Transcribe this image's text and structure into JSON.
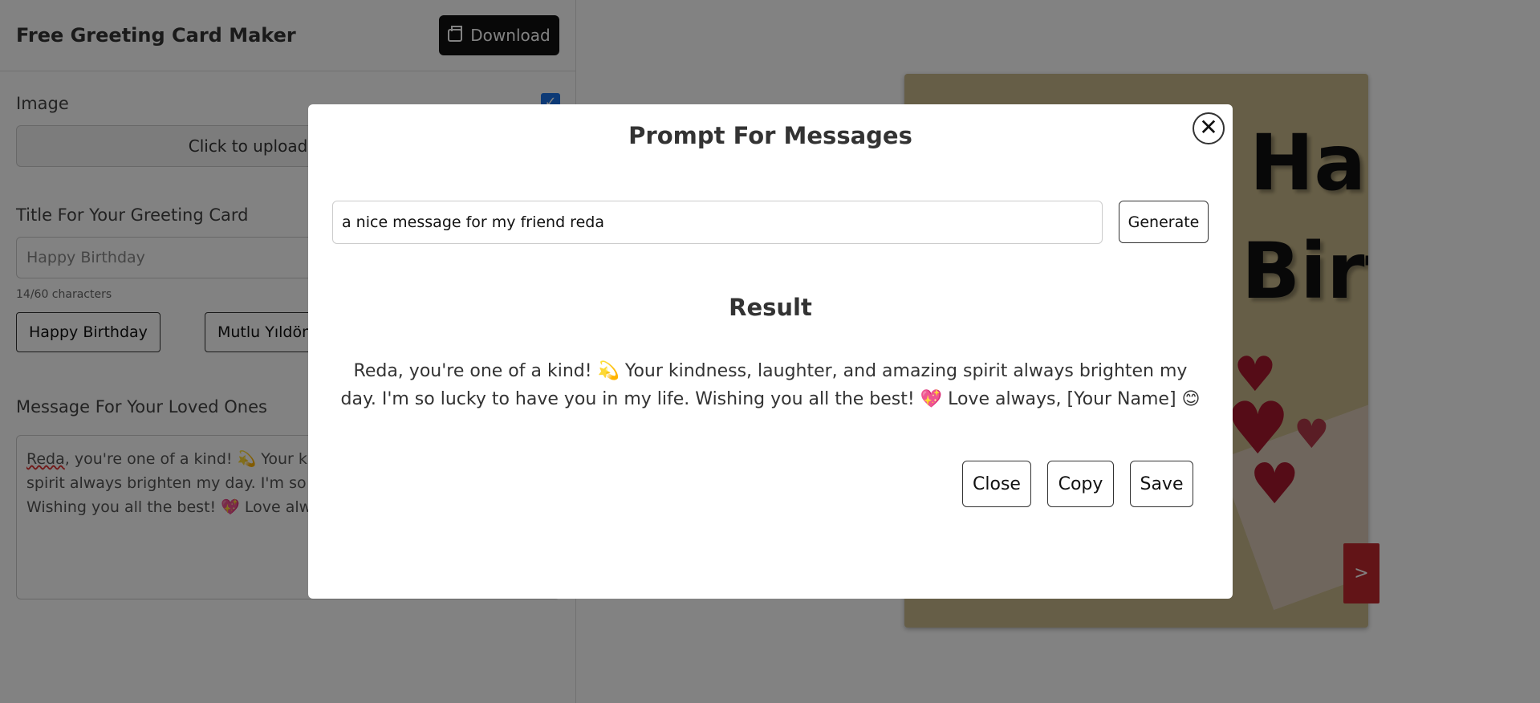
{
  "app": {
    "title": "Free Greeting Card Maker",
    "download_label": "Download"
  },
  "editor": {
    "image_label": "Image",
    "image_checked": true,
    "upload_label": "Click to upload an image",
    "title_label": "Title For Your Greeting Card",
    "title_placeholder": "Happy Birthday",
    "char_count": "14/60 characters",
    "presets": [
      "Happy Birthday",
      "Mutlu Yıldönümü"
    ],
    "message_label": "Message For Your Loved Ones",
    "message_word_1": "Reda",
    "message_rest": ", you're one of a kind! 💫  Your kindness, laughter, and amazing spirit always brighten my day.  I'm so lucky to have you in my life. Wishing you all the best! 💖  Love always, [Your Name] 😊"
  },
  "preview": {
    "title_line_1": "Happy",
    "title_line_2": "Birthday",
    "next_label": ">"
  },
  "modal": {
    "title": "Prompt For Messages",
    "close_icon": "close-icon",
    "prompt_value": "a nice message for my friend reda",
    "generate_label": "Generate",
    "result_heading": "Result",
    "result_text": "Reda, you're one of a kind! 💫  Your kindness, laughter, and amazing spirit always brighten my day. I'm so lucky to have you in my life. Wishing you all the best! 💖  Love always, [Your Name] 😊",
    "close_label": "Close",
    "copy_label": "Copy",
    "save_label": "Save"
  },
  "colors": {
    "overlay": "#000000",
    "card_background": "#c9b98b",
    "next_button": "#c0282d",
    "checkbox": "#1a73e8"
  }
}
